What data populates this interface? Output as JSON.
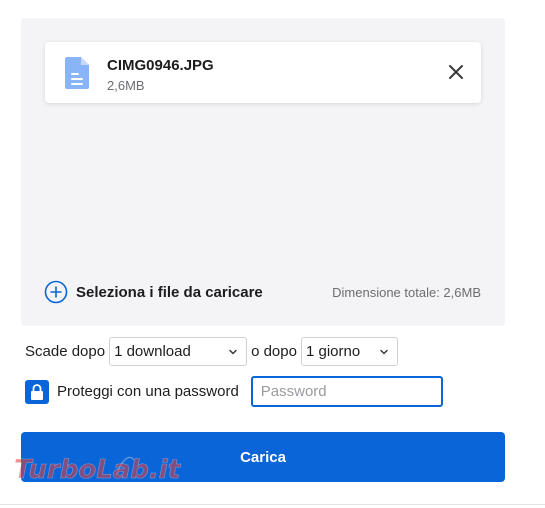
{
  "upload_area": {
    "file": {
      "name": "CIMG0946.JPG",
      "size": "2,6MB",
      "icon": "document-icon",
      "remove_icon": "close-icon"
    },
    "select_files_label": "Seleziona i file da caricare",
    "select_files_icon": "plus-circle-icon",
    "total_size": "Dimensione totale: 2,6MB"
  },
  "expiry": {
    "prefix": "Scade dopo",
    "downloads_value": "1 download",
    "middle": "o dopo",
    "days_value": "1 giorno"
  },
  "password": {
    "checkbox_checked": true,
    "checkbox_icon": "lock-icon",
    "label": "Proteggi con una password",
    "placeholder": "Password",
    "value": ""
  },
  "upload_button": {
    "label": "Carica"
  },
  "watermark": {
    "text": "TurboLab.it"
  },
  "colors": {
    "accent": "#0a66d8",
    "background_panel": "#f4f4f6",
    "file_icon": "#8ab4f8",
    "watermark": "#e23a3a"
  }
}
